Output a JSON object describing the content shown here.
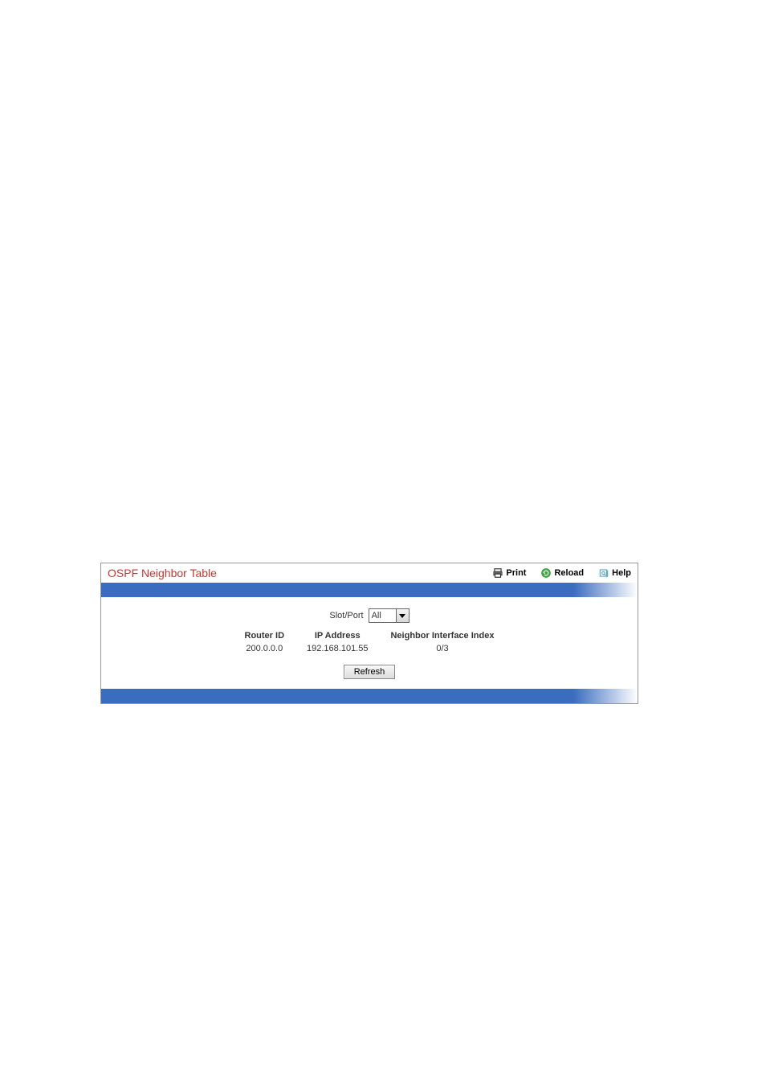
{
  "header": {
    "title": "OSPF Neighbor Table",
    "actions": {
      "print": "Print",
      "reload": "Reload",
      "help": "Help"
    }
  },
  "selector": {
    "label": "Slot/Port",
    "value": "All"
  },
  "table": {
    "columns": [
      "Router ID",
      "IP Address",
      "Neighbor Interface Index"
    ],
    "rows": [
      {
        "router_id": "200.0.0.0",
        "ip_address": "192.168.101.55",
        "neighbor_if_index": "0/3"
      }
    ]
  },
  "buttons": {
    "refresh": "Refresh"
  }
}
